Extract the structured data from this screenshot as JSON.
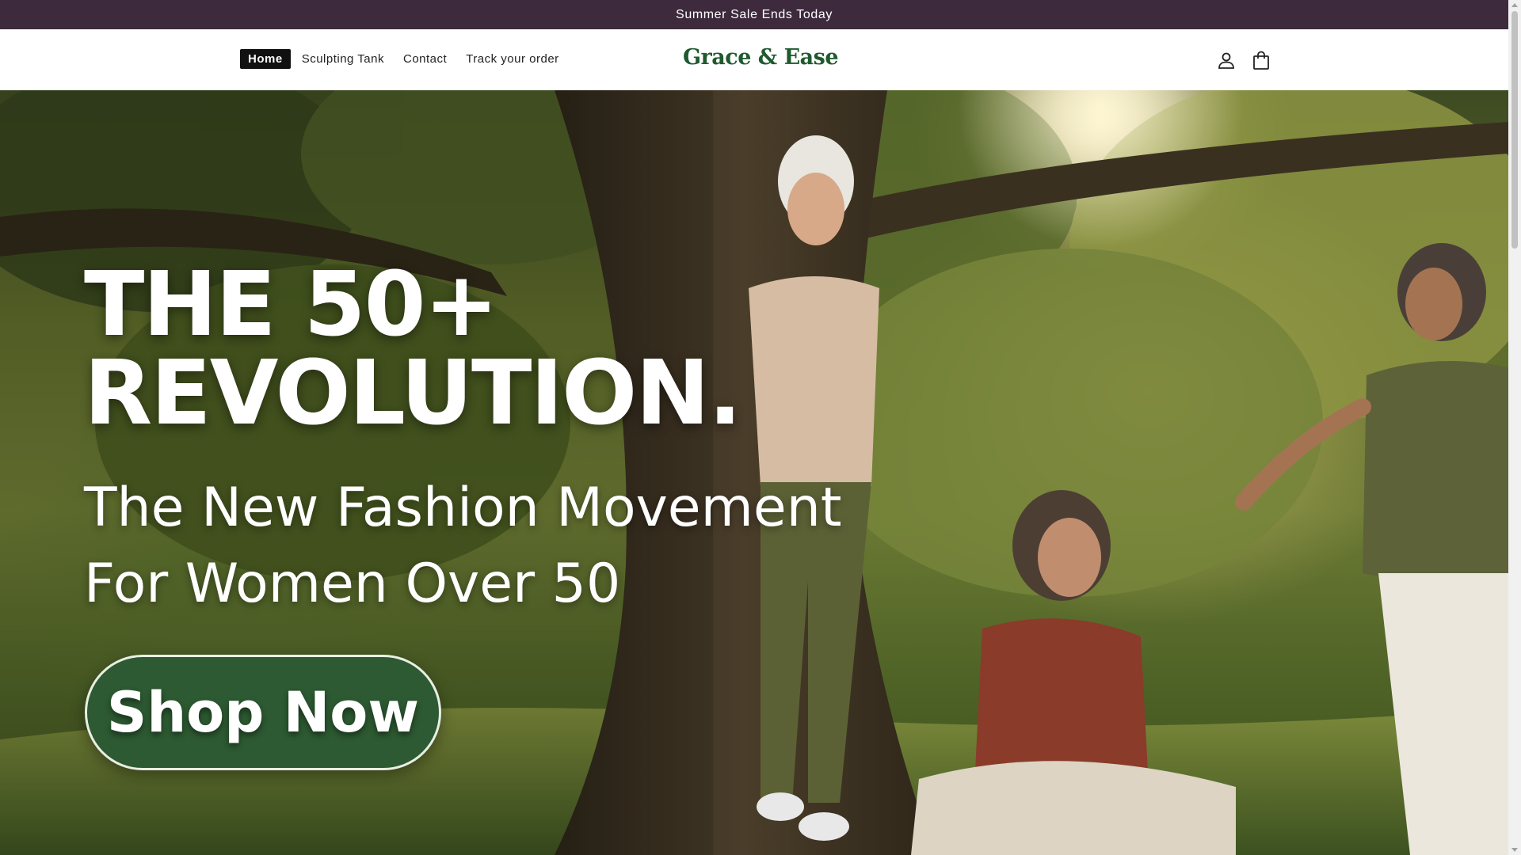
{
  "announcement": {
    "text": "Summer Sale Ends Today"
  },
  "header": {
    "nav": [
      {
        "label": "Home",
        "active": true
      },
      {
        "label": "Sculpting Tank",
        "active": false
      },
      {
        "label": "Contact",
        "active": false
      },
      {
        "label": "Track your order",
        "active": false
      }
    ],
    "logo": "Grace & Ease",
    "icons": [
      "account-icon",
      "cart-icon"
    ]
  },
  "hero": {
    "title_line1": "THE 50+",
    "title_line2": "REVOLUTION.",
    "subtitle_line1": "The New Fashion Movement",
    "subtitle_line2": "For Women Over 50",
    "cta_label": "Shop Now",
    "image_subject": "three smiling older women in tank tops in a sunlit park with a large tree"
  },
  "colors": {
    "announcement_bg": "#3d2a3c",
    "logo": "#1f5a2e",
    "cta_bg": "#2d5a32",
    "nav_active_bg": "#111111"
  }
}
